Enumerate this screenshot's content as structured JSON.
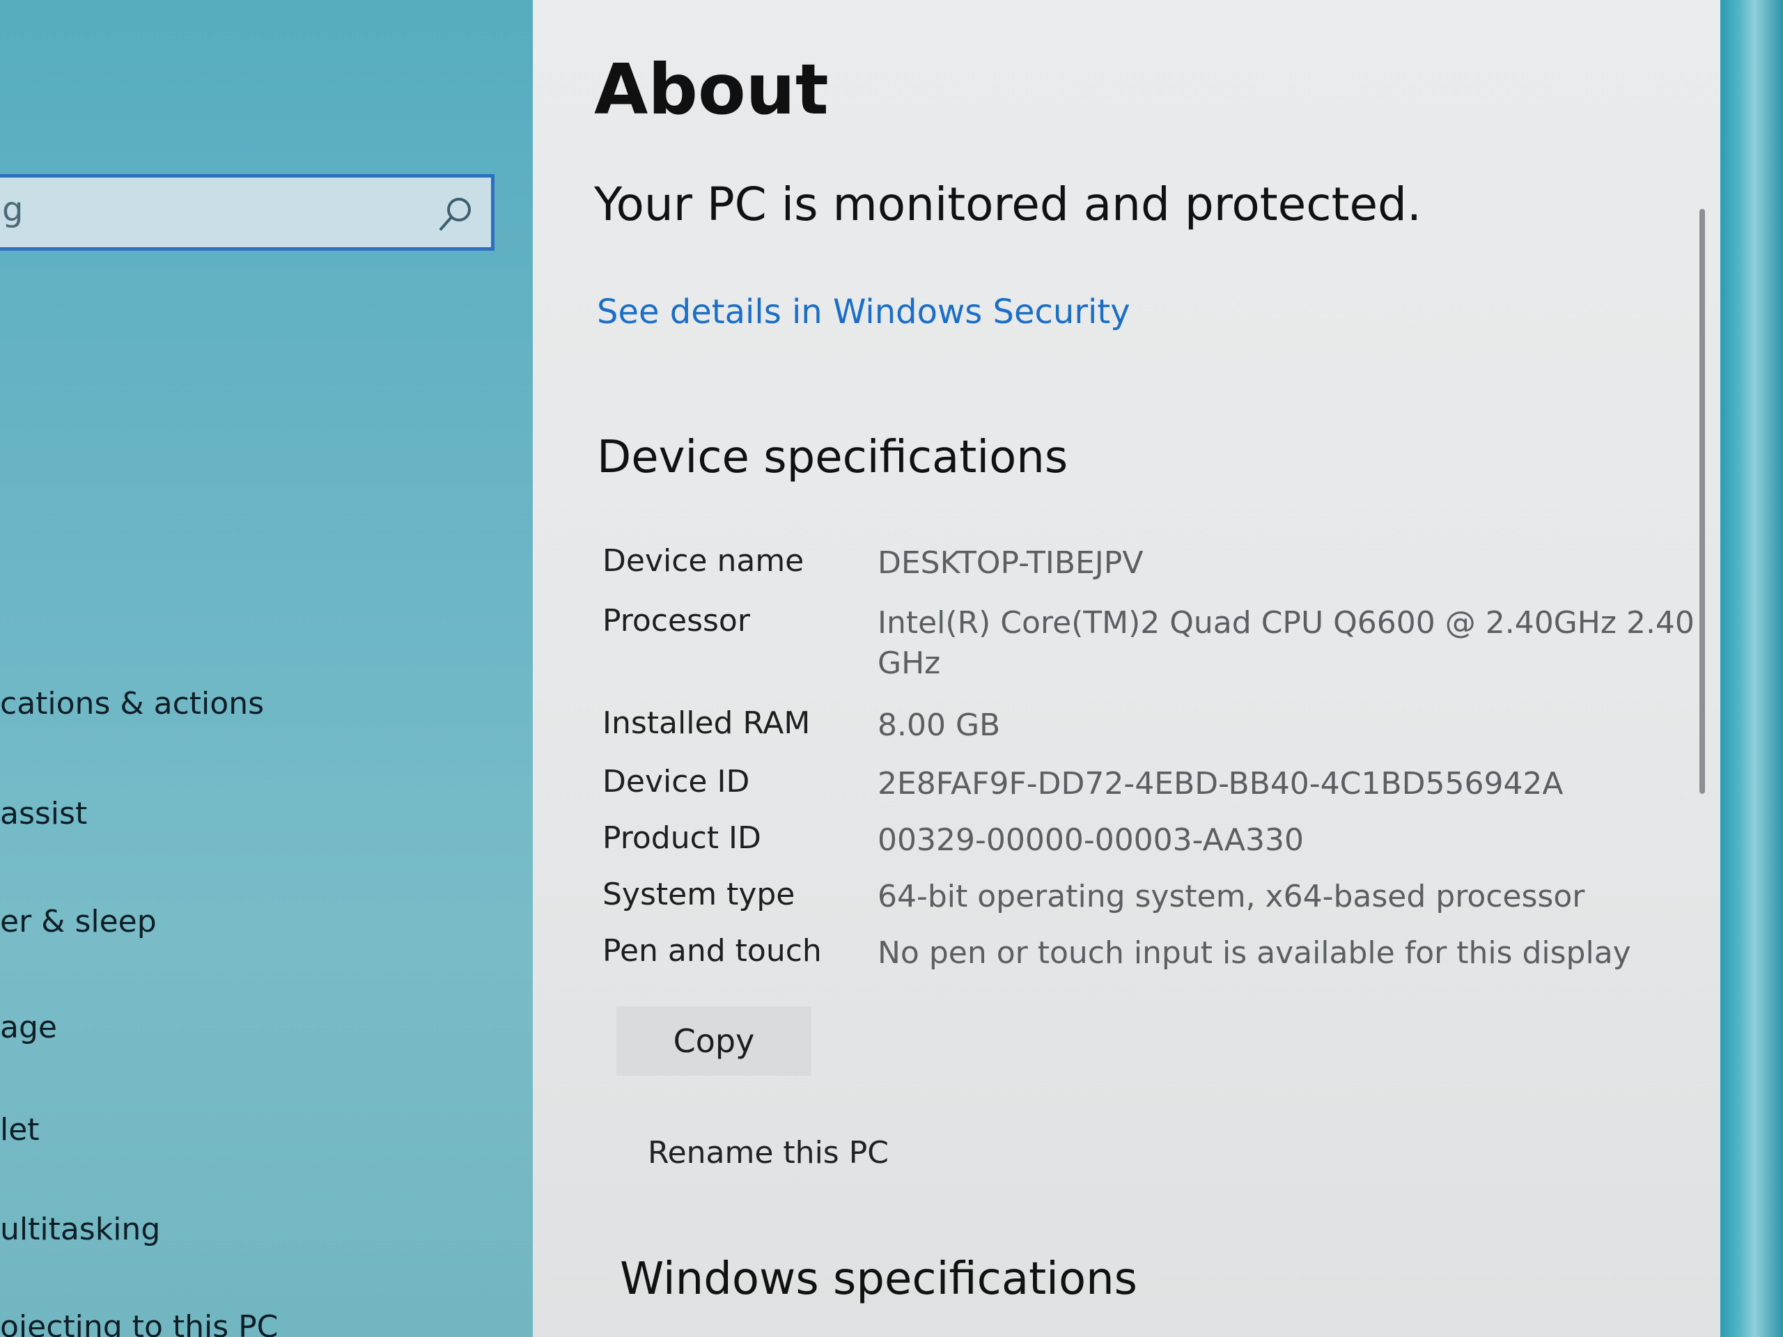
{
  "search": {
    "partial_text": "g"
  },
  "sidebar": {
    "items": [
      {
        "label": "cations & actions"
      },
      {
        "label": " assist"
      },
      {
        "label": "er & sleep"
      },
      {
        "label": "age"
      },
      {
        "label": "let"
      },
      {
        "label": "ultitasking"
      },
      {
        "label": "ojecting to this PC"
      }
    ]
  },
  "main": {
    "title": "About",
    "protection_status": "Your PC is monitored and protected.",
    "security_link": "See details in Windows Security",
    "device_specs": {
      "heading": "Device specifications",
      "rows": [
        {
          "label": "Device name",
          "value": "DESKTOP-TIBEJPV"
        },
        {
          "label": "Processor",
          "value": "Intel(R) Core(TM)2 Quad CPU    Q6600  @ 2.40GHz   2.40 GHz"
        },
        {
          "label": "Installed RAM",
          "value": "8.00 GB"
        },
        {
          "label": "Device ID",
          "value": "2E8FAF9F-DD72-4EBD-BB40-4C1BD556942A"
        },
        {
          "label": "Product ID",
          "value": "00329-00000-00003-AA330"
        },
        {
          "label": "System type",
          "value": "64-bit operating system, x64-based processor"
        },
        {
          "label": "Pen and touch",
          "value": "No pen or touch input is available for this display"
        }
      ],
      "copy_label": "Copy",
      "rename_label": "Rename this PC"
    },
    "windows_specs": {
      "heading": "Windows specifications"
    }
  },
  "colors": {
    "link": "#1a6ec7",
    "search_border": "#2f6fbf",
    "content_bg": "#e7e9ea",
    "wallpaper": "#3aa0b2"
  }
}
